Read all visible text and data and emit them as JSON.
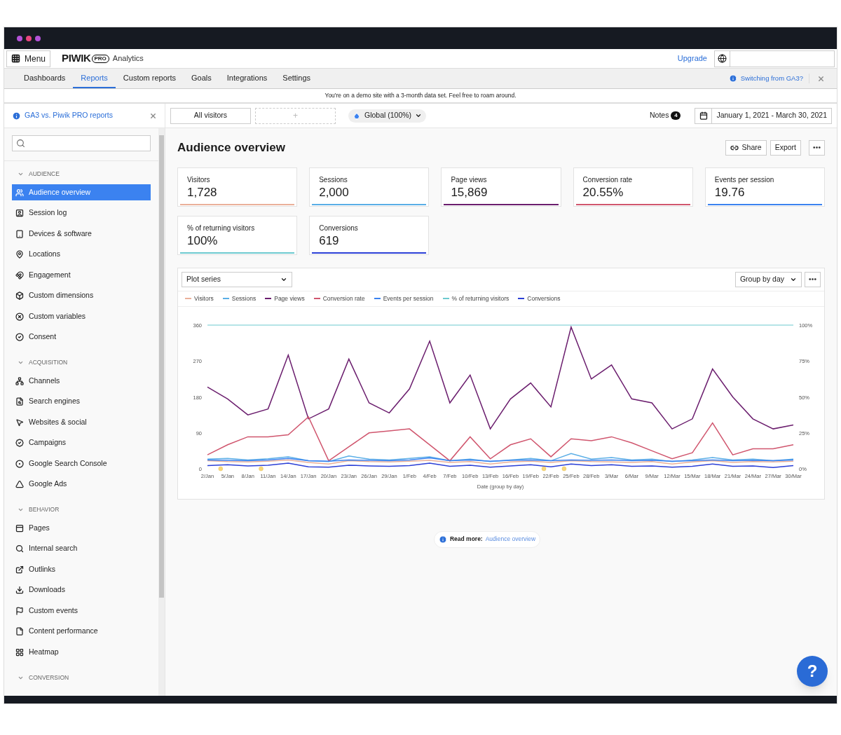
{
  "topbar": {
    "menu_button": "Menu",
    "logo": {
      "wordmark": "PIWIK",
      "badge": "PRO"
    },
    "product": "Analytics",
    "upgrade": "Upgrade"
  },
  "nav": {
    "tabs": [
      {
        "label": "Dashboards",
        "selected": false
      },
      {
        "label": "Reports",
        "selected": true
      },
      {
        "label": "Custom reports",
        "selected": false
      },
      {
        "label": "Goals",
        "selected": false
      },
      {
        "label": "Integrations",
        "selected": false
      },
      {
        "label": "Settings",
        "selected": false
      }
    ],
    "help_link": "Switching from GA3?"
  },
  "banner": "You're on a demo site with a 3-month data set. Feel free to roam around.",
  "sidebar": {
    "notice": "GA3 vs. Piwik PRO reports",
    "sections": [
      {
        "title": "AUDIENCE",
        "expanded": true,
        "items": [
          {
            "label": "Audience overview",
            "selected": true
          },
          {
            "label": "Session log",
            "selected": false
          },
          {
            "label": "Devices & software",
            "selected": false
          },
          {
            "label": "Locations",
            "selected": false
          },
          {
            "label": "Engagement",
            "selected": false
          },
          {
            "label": "Custom dimensions",
            "selected": false
          },
          {
            "label": "Custom variables",
            "selected": false
          },
          {
            "label": "Consent",
            "selected": false
          }
        ]
      },
      {
        "title": "ACQUISITION",
        "expanded": true,
        "items": [
          {
            "label": "Channels",
            "selected": false
          },
          {
            "label": "Search engines",
            "selected": false
          },
          {
            "label": "Websites & social",
            "selected": false
          },
          {
            "label": "Campaigns",
            "selected": false
          },
          {
            "label": "Google Search Console",
            "selected": false
          },
          {
            "label": "Google Ads",
            "selected": false
          }
        ]
      },
      {
        "title": "BEHAVIOR",
        "expanded": true,
        "items": [
          {
            "label": "Pages",
            "selected": false
          },
          {
            "label": "Internal search",
            "selected": false
          },
          {
            "label": "Outlinks",
            "selected": false
          },
          {
            "label": "Downloads",
            "selected": false
          },
          {
            "label": "Custom events",
            "selected": false
          },
          {
            "label": "Content performance",
            "selected": false
          },
          {
            "label": "Heatmap",
            "selected": false
          }
        ]
      },
      {
        "title": "CONVERSION",
        "expanded": true
      }
    ]
  },
  "toolbar": {
    "segment": "All visitors",
    "add_segment": "+",
    "scope": "Global (100%)",
    "notes": {
      "label": "Notes",
      "count": "4"
    },
    "date_range": "January 1, 2021 - March 30, 2021"
  },
  "report": {
    "title": "Audience overview",
    "actions": [
      "Share",
      "Export"
    ],
    "metrics": [
      {
        "label": "Visitors",
        "value": "1,728",
        "color": "#eab09a"
      },
      {
        "label": "Sessions",
        "value": "2,000",
        "color": "#5aaee6"
      },
      {
        "label": "Page views",
        "value": "15,869",
        "color": "#6b1e6e"
      },
      {
        "label": "Conversion rate",
        "value": "20.55%",
        "color": "#d0566e"
      },
      {
        "label": "Events per session",
        "value": "19.76",
        "color": "#3b82f0"
      },
      {
        "label": "% of returning visitors",
        "value": "100%",
        "color": "#6cc9cf"
      },
      {
        "label": "Conversions",
        "value": "619",
        "color": "#2b3fd6"
      }
    ],
    "plot_series": "Plot series",
    "group_by": "Group by day",
    "chart_data": {
      "type": "line",
      "xlabel": "Date (group by day)",
      "categories": [
        "2/Jan",
        "5/Jan",
        "8/Jan",
        "11/Jan",
        "14/Jan",
        "17/Jan",
        "20/Jan",
        "23/Jan",
        "26/Jan",
        "29/Jan",
        "1/Feb",
        "4/Feb",
        "7/Feb",
        "10/Feb",
        "13/Feb",
        "16/Feb",
        "19/Feb",
        "22/Feb",
        "25/Feb",
        "28/Feb",
        "3/Mar",
        "6/Mar",
        "9/Mar",
        "12/Mar",
        "15/Mar",
        "18/Mar",
        "21/Mar",
        "24/Mar",
        "27/Mar",
        "30/Mar"
      ],
      "ylim": [
        0,
        360
      ],
      "yticks": [
        0,
        90,
        180,
        270,
        360
      ],
      "y2lim": [
        0,
        100
      ],
      "y2ticks": [
        {
          "value": 0,
          "label": "0%"
        },
        {
          "value": 25,
          "label": "25%"
        },
        {
          "value": 50,
          "label": "50%"
        },
        {
          "value": 75,
          "label": "75%"
        },
        {
          "value": 100,
          "label": "100%"
        }
      ],
      "series": [
        {
          "name": "Visitors",
          "color": "#eab09a",
          "values": [
            20,
            18,
            17,
            19,
            22,
            16,
            12,
            20,
            18,
            17,
            19,
            21,
            16,
            18,
            12,
            17,
            19,
            16,
            20,
            18,
            17,
            16,
            18,
            12,
            17,
            20,
            16,
            18,
            17,
            19
          ]
        },
        {
          "name": "Sessions",
          "color": "#5aaee6",
          "values": [
            24,
            26,
            22,
            25,
            30,
            20,
            18,
            32,
            24,
            22,
            26,
            30,
            20,
            24,
            18,
            22,
            26,
            20,
            38,
            24,
            28,
            22,
            24,
            18,
            22,
            28,
            22,
            24,
            20,
            24
          ]
        },
        {
          "name": "Page views",
          "color": "#6b1e6e",
          "values": [
            205,
            175,
            135,
            150,
            285,
            125,
            150,
            275,
            165,
            140,
            200,
            320,
            165,
            235,
            100,
            175,
            215,
            155,
            355,
            225,
            260,
            175,
            165,
            100,
            125,
            250,
            180,
            125,
            100,
            110
          ]
        },
        {
          "name": "Conversion rate",
          "color": "#d0566e",
          "values": [
            35,
            60,
            80,
            80,
            85,
            130,
            20,
            55,
            90,
            95,
            100,
            60,
            20,
            80,
            25,
            60,
            75,
            30,
            75,
            70,
            80,
            65,
            45,
            25,
            40,
            115,
            35,
            50,
            50,
            60
          ]
        },
        {
          "name": "Events per session",
          "color": "#3b82f0",
          "values": [
            22,
            21,
            20,
            22,
            26,
            20,
            19,
            22,
            21,
            20,
            22,
            27,
            20,
            22,
            19,
            21,
            22,
            20,
            22,
            21,
            22,
            20,
            21,
            19,
            20,
            22,
            20,
            21,
            20,
            22
          ]
        },
        {
          "name": "% of returning visitors",
          "color": "#6cc9cf",
          "axis": "y2",
          "values": [
            100,
            100,
            100,
            100,
            100,
            100,
            100,
            100,
            100,
            100,
            100,
            100,
            100,
            100,
            100,
            100,
            100,
            100,
            100,
            100,
            100,
            100,
            100,
            100,
            100,
            100,
            100,
            100,
            100,
            100
          ]
        },
        {
          "name": "Conversions",
          "color": "#2b3fd6",
          "values": [
            8,
            10,
            7,
            9,
            14,
            5,
            4,
            9,
            7,
            6,
            8,
            14,
            6,
            9,
            4,
            7,
            10,
            5,
            12,
            8,
            10,
            6,
            7,
            4,
            6,
            12,
            6,
            7,
            3,
            8
          ]
        }
      ],
      "annotations": [
        {
          "x": "5/Jan"
        },
        {
          "x": "11/Jan"
        },
        {
          "x": "22/Feb"
        },
        {
          "x": "25/Feb"
        }
      ]
    }
  },
  "read_more": {
    "label": "Read more:",
    "link": "Audience overview"
  },
  "help_button": "?"
}
